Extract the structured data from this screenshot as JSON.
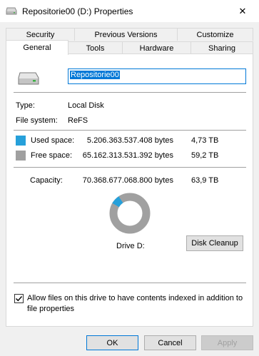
{
  "window": {
    "title": "Repositorie00 (D:) Properties",
    "close_symbol": "✕"
  },
  "tabs_row1": [
    {
      "label": "Security"
    },
    {
      "label": "Previous Versions"
    },
    {
      "label": "Customize"
    }
  ],
  "tabs_row2": [
    {
      "label": "General",
      "active": true
    },
    {
      "label": "Tools"
    },
    {
      "label": "Hardware"
    },
    {
      "label": "Sharing"
    }
  ],
  "general": {
    "drive_icon": "drive-icon",
    "name_value": "Repositorie00",
    "type_label": "Type:",
    "type_value": "Local Disk",
    "fs_label": "File system:",
    "fs_value": "ReFS",
    "used_label": "Used space:",
    "used_bytes": "5.206.363.537.408 bytes",
    "used_human": "4,73 TB",
    "free_label": "Free space:",
    "free_bytes": "65.162.313.531.392 bytes",
    "free_human": "59,2 TB",
    "capacity_label": "Capacity:",
    "capacity_bytes": "70.368.677.068.800 bytes",
    "capacity_human": "63,9 TB",
    "drive_label": "Drive D:",
    "cleanup_button": "Disk Cleanup",
    "index_checkbox_checked": true,
    "index_checkbox_label_line1": "Allow files on this drive to have contents indexed in addition to",
    "index_checkbox_label_line2": "file properties"
  },
  "colors": {
    "used": "#26a0da",
    "free": "#a0a0a0",
    "accent": "#0078d7"
  },
  "usage": {
    "used_fraction": 0.074
  },
  "buttons": {
    "ok": "OK",
    "cancel": "Cancel",
    "apply": "Apply"
  }
}
